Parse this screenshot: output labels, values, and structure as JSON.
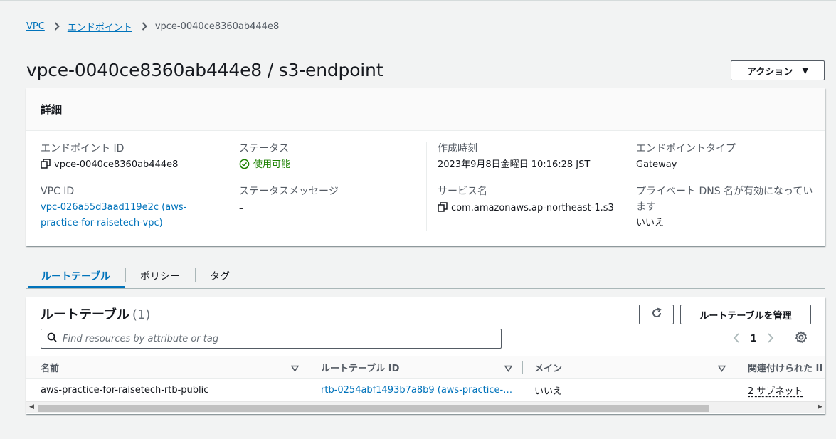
{
  "breadcrumb": {
    "vpc": "VPC",
    "endpoints": "エンドポイント",
    "current": "vpce-0040ce8360ab444e8"
  },
  "page_title": "vpce-0040ce8360ab444e8 / s3-endpoint",
  "action_button": "アクション",
  "details": {
    "header": "詳細",
    "endpoint_id_label": "エンドポイント ID",
    "endpoint_id_value": "vpce-0040ce8360ab444e8",
    "vpc_id_label": "VPC ID",
    "vpc_id_value_line1": "vpc-026a55d3aad119e2c (aws-",
    "vpc_id_value_line2": "practice-for-raisetech-vpc)",
    "status_label": "ステータス",
    "status_value": "使用可能",
    "status_message_label": "ステータスメッセージ",
    "status_message_value": "–",
    "created_label": "作成時刻",
    "created_value": "2023年9月8日金曜日 10:16:28 JST",
    "service_label": "サービス名",
    "service_value": "com.amazonaws.ap-northeast-1.s3",
    "endpoint_type_label": "エンドポイントタイプ",
    "endpoint_type_value": "Gateway",
    "private_dns_label_line1": "プライベート DNS 名が有効になってい",
    "private_dns_label_line2": "ます",
    "private_dns_value": "いいえ"
  },
  "tabs": [
    "ルートテーブル",
    "ポリシー",
    "タグ"
  ],
  "route_tables": {
    "title": "ルートテーブル",
    "count": "(1)",
    "manage_button": "ルートテーブルを管理",
    "search_placeholder": "Find resources by attribute or tag",
    "page": "1",
    "columns": [
      "名前",
      "ルートテーブル ID",
      "メイン",
      "関連付けられた II"
    ],
    "rows": [
      {
        "name": "aws-practice-for-raisetech-rtb-public",
        "id": "rtb-0254abf1493b7a8b9 (aws-practice-…",
        "main": "いいえ",
        "associated": "2 サブネット"
      }
    ]
  },
  "colors": {
    "link": "#0073bb",
    "success": "#1d8102",
    "text": "#16191f"
  }
}
